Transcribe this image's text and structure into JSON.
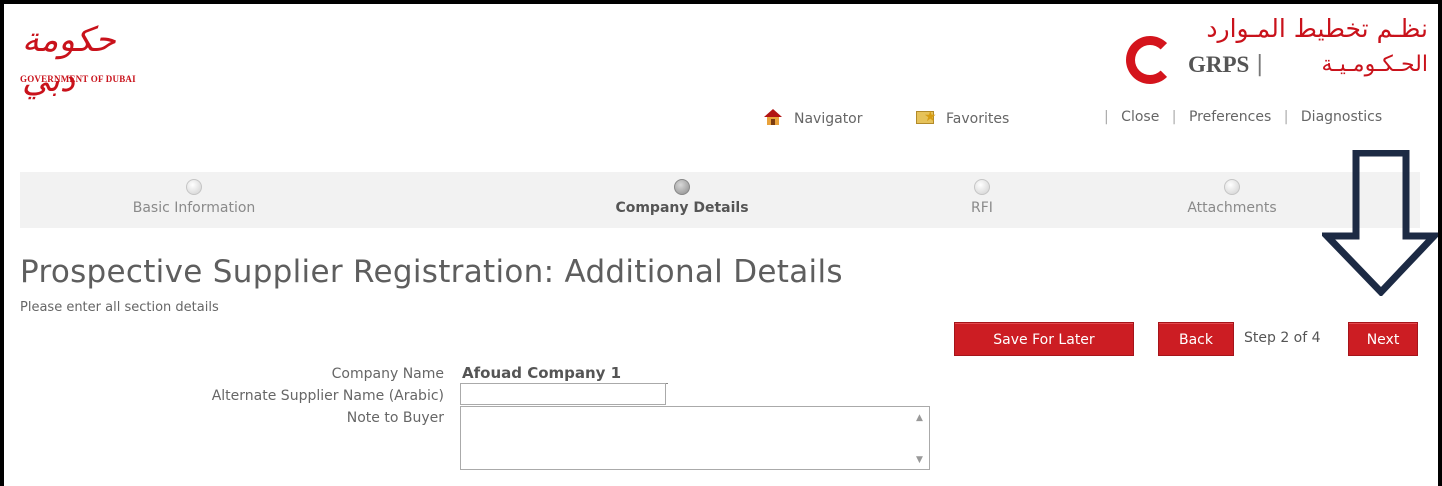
{
  "header": {
    "dubai_logo_arabic": "حكومة دبي",
    "dubai_logo_english": "GOVERNMENT OF DUBAI",
    "grps_logo_arabic_line1": "نظـم تخطيط المـوارد",
    "grps_logo_acronym": "GRPS",
    "grps_logo_separator": "|",
    "grps_logo_arabic_line2": "الحـكـومـيـة"
  },
  "global_nav": {
    "navigator": "Navigator",
    "favorites": "Favorites",
    "separator": "|",
    "close": "Close",
    "preferences": "Preferences",
    "diagnostics": "Diagnostics"
  },
  "train": {
    "steps": [
      {
        "label": "Basic Information",
        "active": false
      },
      {
        "label": "Company Details",
        "active": true
      },
      {
        "label": "RFI",
        "active": false
      },
      {
        "label": "Attachments",
        "active": false
      }
    ]
  },
  "page": {
    "title": "Prospective Supplier Registration: Additional Details",
    "instructions": "Please enter all section details"
  },
  "buttons": {
    "save_for_later": "Save For Later",
    "back": "Back",
    "step_counter": "Step 2 of 4",
    "next": "Next"
  },
  "form": {
    "company_name_label": "Company Name",
    "company_name_value": "Afouad Company 1",
    "alt_supplier_label": "Alternate Supplier Name (Arabic)",
    "alt_supplier_value": "",
    "note_label": "Note to Buyer",
    "note_value": ""
  },
  "colors": {
    "brand_red": "#cc1d23",
    "train_bg": "#f2f2f2",
    "annotation_arrow": "#1c2a44"
  }
}
